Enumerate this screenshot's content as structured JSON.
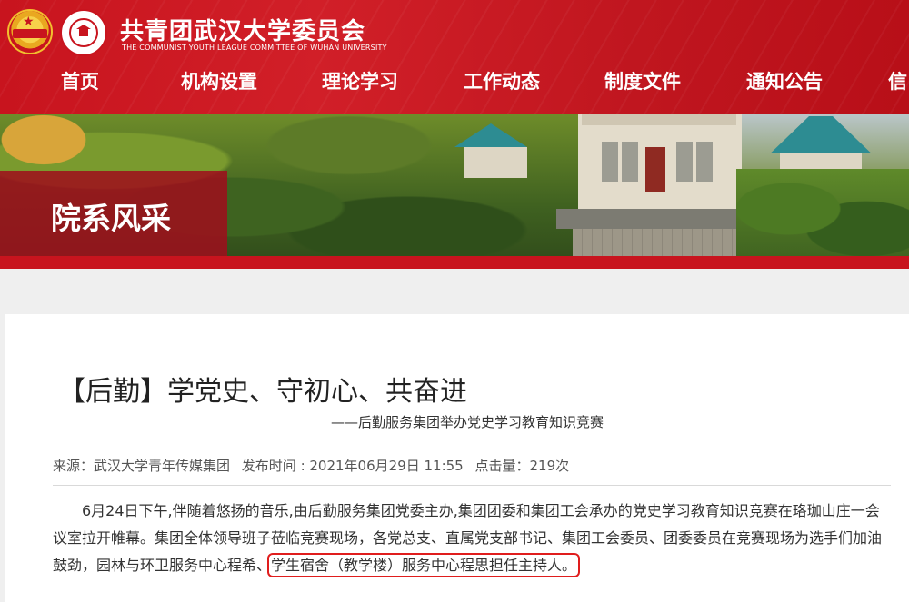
{
  "header": {
    "site_title": "共青团武汉大学委员会",
    "site_subtitle": "THE COMMUNIST YOUTH LEAGUE COMMITTEE OF WUHAN UNIVERSITY",
    "brand_color": "#c8141e"
  },
  "nav": {
    "items": [
      "首页",
      "机构设置",
      "理论学习",
      "工作动态",
      "制度文件",
      "通知公告",
      "信"
    ]
  },
  "banner": {
    "section_title": "院系风采"
  },
  "article": {
    "title": "【后勤】学党史、守初心、共奋进",
    "subtitle": "——后勤服务集团举办党史学习教育知识竞赛",
    "meta": {
      "source": "来源：武汉大学青年传媒集团",
      "published": "发布时间 : 2021年06月29日 11:55",
      "views": "点击量：219次"
    },
    "body": {
      "line1": "6月24日下午,伴随着悠扬的音乐,由后勤服务集团党委主办,集团团委和集团工会承办的党史学习教育知识竞赛在珞珈山庄一会",
      "line2": "议室拉开帷幕。集团全体领导班子莅临竞赛现场，各党总支、直属党支部书记、集团工会委员、团委委员在竞赛现场为选手们加油",
      "line3_before": "鼓劲，园林与环卫服务中心程希、",
      "line3_highlight": "学生宿舍（教学楼）服务中心程思担任主持人。"
    }
  }
}
